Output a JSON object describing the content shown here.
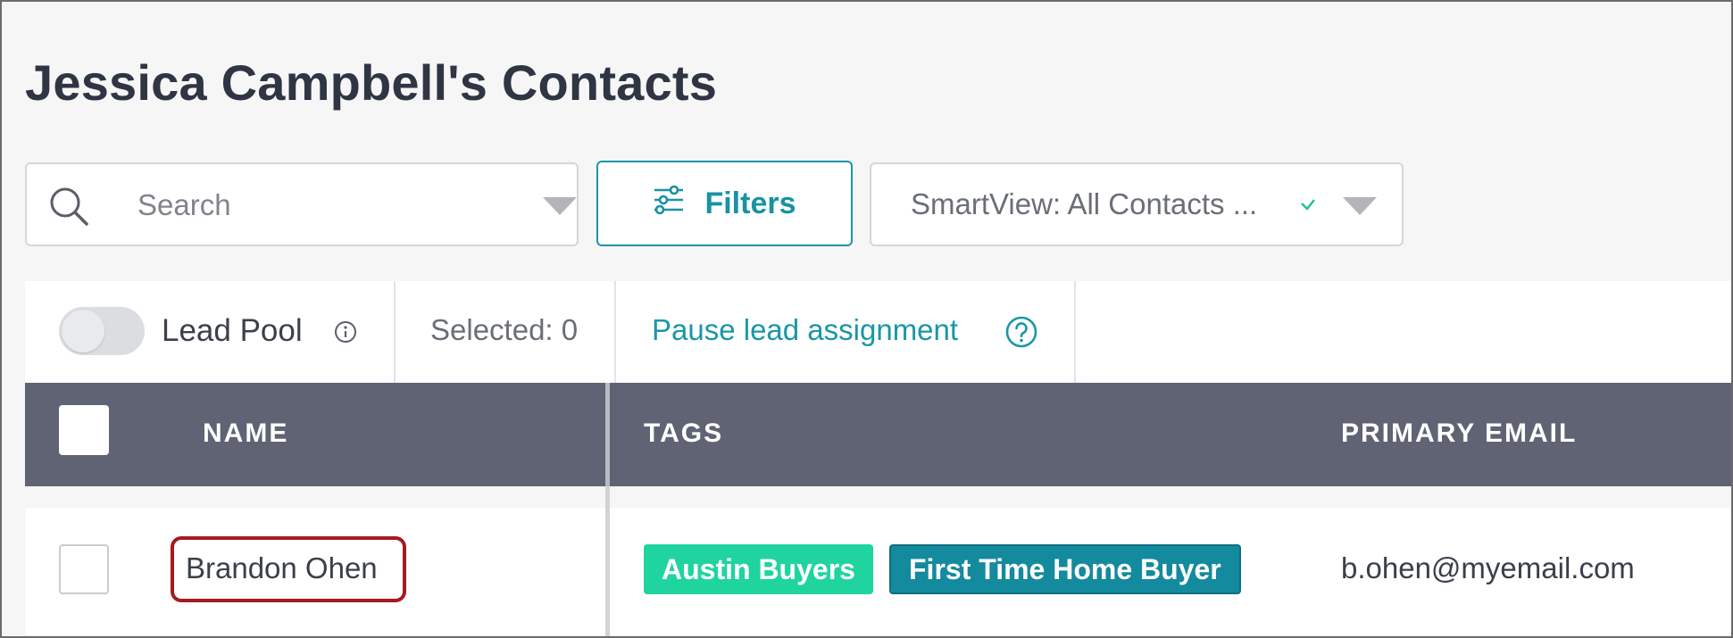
{
  "page": {
    "title": "Jessica Campbell's Contacts"
  },
  "search": {
    "placeholder": "Search",
    "value": ""
  },
  "filters": {
    "label": "Filters"
  },
  "smartview": {
    "label": "SmartView: All Contacts ..."
  },
  "toolbar": {
    "lead_pool_label": "Lead Pool",
    "lead_pool_enabled": false,
    "selected_label": "Selected: 0",
    "pause_link": "Pause lead assignment"
  },
  "table": {
    "columns": [
      "NAME",
      "TAGS",
      "PRIMARY EMAIL"
    ],
    "rows": [
      {
        "name": "Brandon Ohen",
        "tags": [
          "Austin Buyers",
          "First Time Home Buyer"
        ],
        "email": "b.ohen@myemail.com"
      }
    ]
  },
  "colors": {
    "accent": "#1997a6",
    "header_bg": "#5f6374",
    "tag_austin": "#20d4a0",
    "tag_first_time": "#148a9e",
    "highlight": "#a61b1e"
  }
}
